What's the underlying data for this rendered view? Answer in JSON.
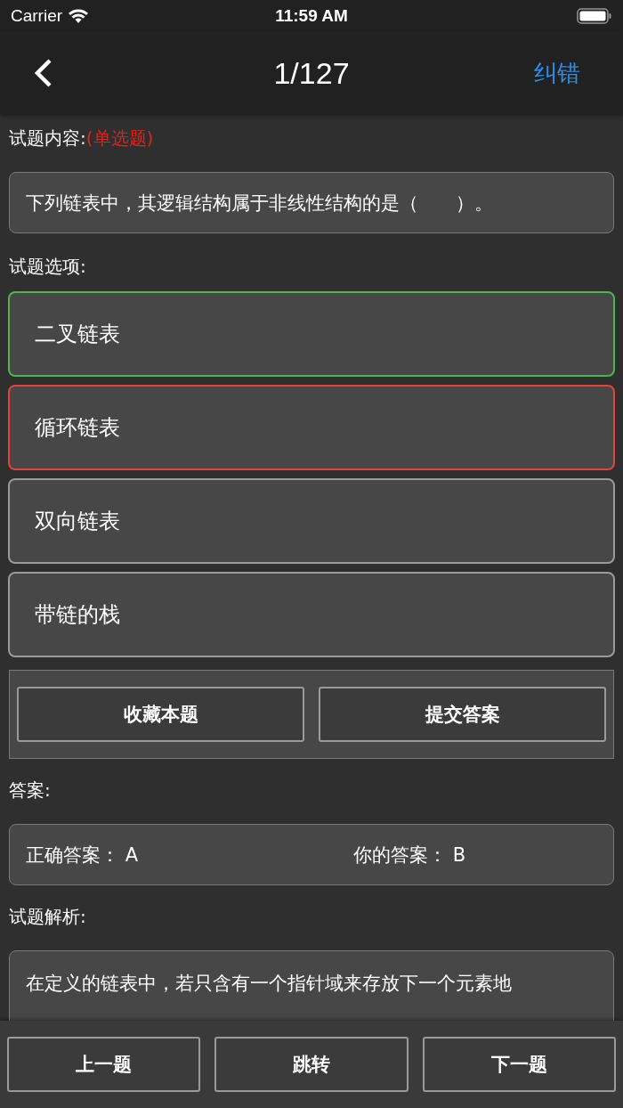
{
  "status_bar": {
    "carrier": "Carrier",
    "time": "11:59 AM"
  },
  "nav": {
    "title": "1/127",
    "action": "纠错"
  },
  "question": {
    "label": "试题内容:",
    "type": "(单选题)",
    "text": "下列链表中，其逻辑结构属于非线性结构的是（　　）。"
  },
  "options_label": "试题选项:",
  "options": [
    {
      "text": "二叉链表",
      "correct": true,
      "selected": false
    },
    {
      "text": "循环链表",
      "correct": false,
      "selected": true
    },
    {
      "text": "双向链表",
      "correct": false,
      "selected": false
    },
    {
      "text": "带链的栈",
      "correct": false,
      "selected": false
    }
  ],
  "actions": [
    "收藏本题",
    "提交答案"
  ],
  "answer": {
    "label": "答案:",
    "correct_label": "正确答案：",
    "correct": "A",
    "yours_label": "你的答案：",
    "yours": "B"
  },
  "analysis": {
    "label": "试题解析:",
    "text": "在定义的链表中，若只含有一个指针域来存放下一个元素地"
  },
  "bottom_buttons": [
    "上一题",
    "跳转",
    "下一题"
  ]
}
